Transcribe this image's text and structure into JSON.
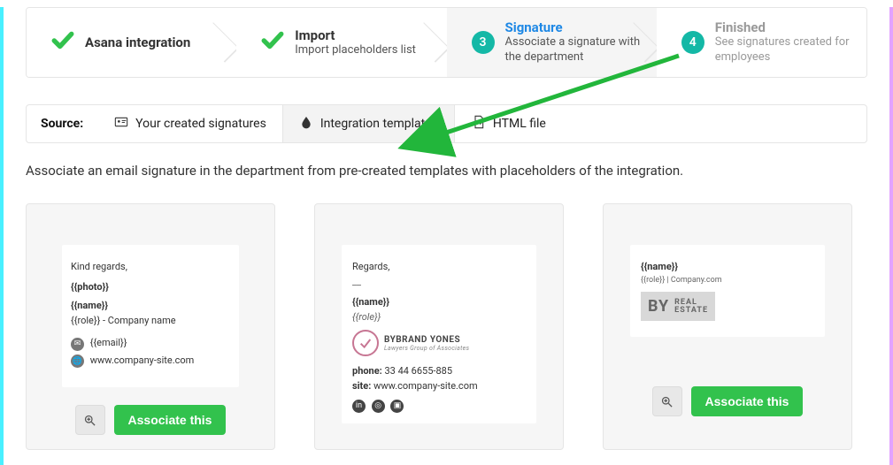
{
  "stepper": {
    "steps": [
      {
        "title": "Asana integration",
        "desc": "",
        "state": "done"
      },
      {
        "title": "Import",
        "desc": "Import placeholders list",
        "state": "done"
      },
      {
        "num": "3",
        "title": "Signature",
        "desc": "Associate a signature with the department",
        "state": "active"
      },
      {
        "num": "4",
        "title": "Finished",
        "desc": "See signatures created for employees",
        "state": "disabled"
      }
    ]
  },
  "source": {
    "label": "Source:",
    "tabs": [
      {
        "id": "created",
        "label": "Your created signatures"
      },
      {
        "id": "integration",
        "label": "Integration templates"
      },
      {
        "id": "html",
        "label": "HTML file"
      }
    ],
    "active": "integration"
  },
  "description": "Associate an email signature in the department from pre-created templates with placeholders of the integration.",
  "buttons": {
    "associate": "Associate this"
  },
  "templates": [
    {
      "greeting": "Kind regards,",
      "lines": [
        {
          "text": "{{photo}}",
          "bold": true
        },
        {
          "text": "{{name}}",
          "bold": true
        },
        {
          "text": "{{role}} - Company name"
        }
      ],
      "contacts": [
        {
          "icon": "mail",
          "text": "{{email}}"
        },
        {
          "icon": "globe",
          "text": "www.company-site.com"
        }
      ]
    },
    {
      "greeting": "Regards,",
      "greeting_sep": "__",
      "name_line": "{{name}}",
      "role_line": "{{role}}",
      "brand1": "BYBRAND YONES",
      "brand2": "Lawyers Group of Associates",
      "phone_label": "phone:",
      "phone": "33 44 6655-885",
      "site_label": "site:",
      "site": "www.company-site.com",
      "socials": [
        "in",
        "◎",
        "▣"
      ]
    },
    {
      "name_line": "{{name}}",
      "role_line": "{{role}} | Company.com",
      "by_label": "BY",
      "real": "REAL",
      "estate": "ESTATE"
    }
  ]
}
